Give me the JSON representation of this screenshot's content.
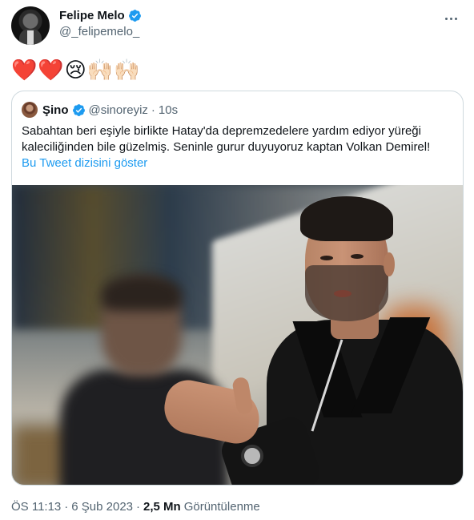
{
  "author": {
    "display_name": "Felipe Melo",
    "handle": "@_felipemelo_",
    "verified": true
  },
  "tweet": {
    "emojis": [
      "❤️",
      "❤️",
      "😢",
      "🙌🏻",
      "🙌🏻"
    ]
  },
  "quoted_tweet": {
    "display_name": "Şino",
    "handle": "@sinoreyiz",
    "separator": "·",
    "time": "10s",
    "text": "Sabahtan beri eşiyle birlikte Hatay'da depremzedelere yardım ediyor yüreği kaleciliğinden bile güzelmiş. Seninle gurur duyuyoruz kaptan Volkan Demirel!",
    "thread_link": "Bu Tweet dizisini göster"
  },
  "meta": {
    "time": "ÖS 11:13",
    "separator1": "·",
    "date": "6 Şub 2023",
    "separator2": "·",
    "views_count": "2,5 Mn",
    "views_label": "Görüntülenme"
  },
  "colors": {
    "accent": "#1d9bf0",
    "secondary_text": "#536471",
    "border": "#cfd9de"
  },
  "icons": [
    "verified-badge-icon",
    "more-options-icon"
  ]
}
